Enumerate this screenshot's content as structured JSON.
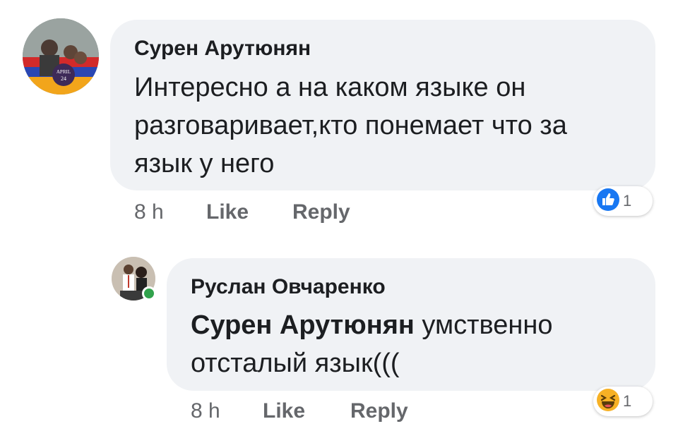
{
  "comments": [
    {
      "author": "Сурен Арутюнян",
      "lines": [
        "Интересно а на каком языке он",
        "разговаривает,кто понемает что за",
        "язык у него"
      ],
      "time": "8 h",
      "like_label": "Like",
      "reply_label": "Reply",
      "reaction_count": "1",
      "reaction_icon": "like-reaction-icon",
      "reaction_color": "#1877f2"
    },
    {
      "author": "Руслан Овчаренко",
      "mention": "Сурен Арутюнян",
      "text_after_mention": " умственно",
      "line2": "отсталый язык(((",
      "time": "8 h",
      "like_label": "Like",
      "reply_label": "Reply",
      "reaction_count": "1",
      "reaction_icon": "haha-reaction-icon",
      "reaction_color": "#f7b125"
    }
  ],
  "colors": {
    "bubble": "#f0f2f5",
    "meta": "#65676b",
    "text": "#1c1e21",
    "online": "#31a24c"
  }
}
